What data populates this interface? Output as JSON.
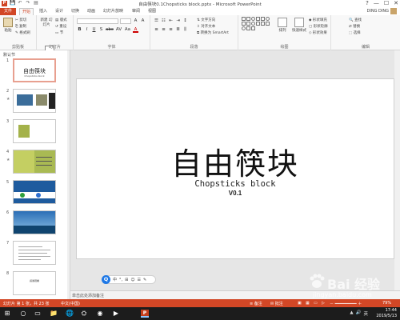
{
  "window": {
    "title": "自由筷块0.1Chopsticks block.pptx - Microsoft PowerPoint",
    "app_icon_label": "P",
    "minimize": "—",
    "maximize": "☐",
    "close": "✕",
    "qat": [
      "💾",
      "↶",
      "↷",
      "▤"
    ]
  },
  "tabs": {
    "file": "文件",
    "items": [
      "开始",
      "插入",
      "设计",
      "切换",
      "动画",
      "幻灯片放映",
      "审阅",
      "视图"
    ],
    "active_index": 0,
    "user": "DING DING",
    "help": "?"
  },
  "ribbon": {
    "clipboard": {
      "paste": "粘贴",
      "cut": "剪切",
      "copy": "复制",
      "format_painter": "格式刷",
      "label": "剪贴板"
    },
    "slides": {
      "new_slide": "新建\n幻灯片",
      "layout": "版式",
      "reset": "重设",
      "section": "节",
      "label": "幻灯片"
    },
    "font": {
      "label": "字体",
      "row1": [
        "B",
        "I",
        "U",
        "S",
        "abc",
        "AV",
        "Aa",
        "A"
      ],
      "grow": "A",
      "shrink": "A",
      "clear": "✗"
    },
    "paragraph": {
      "label": "段落",
      "text_direction": "文字方向",
      "align_text": "对齐文本",
      "smartart": "转换为 SmartArt"
    },
    "drawing": {
      "label": "绘图",
      "arrange": "排列",
      "quick_styles": "快速样式",
      "shape_fill": "形状填充",
      "shape_outline": "形状轮廓",
      "shape_effects": "形状效果"
    },
    "editing": {
      "label": "编辑",
      "find": "查找",
      "replace": "替换",
      "select": "选择"
    }
  },
  "thumbnails": {
    "section": "默认节",
    "slides": [
      {
        "num": "1",
        "title": "自由筷块",
        "subtitle": "Chopsticks block"
      },
      {
        "num": "2"
      },
      {
        "num": "3"
      },
      {
        "num": "4"
      },
      {
        "num": "5"
      },
      {
        "num": "6"
      },
      {
        "num": "7"
      },
      {
        "num": "8",
        "title": "感谢观看"
      }
    ],
    "selected_index": 0
  },
  "slide": {
    "title": "自由筷块",
    "subtitle": "Chopsticks block",
    "version": "V0.1"
  },
  "ime": {
    "logo": "Q",
    "items": [
      "中",
      "°,",
      "⊞",
      "☺",
      "☰",
      "✎"
    ]
  },
  "notes": {
    "placeholder": "单击此处添加备注"
  },
  "statusbar": {
    "slide_info": "幻灯片 第 1 张，共 23 张",
    "language": "中文(中国)",
    "notes": "备注",
    "comments": "批注",
    "zoom": "79%"
  },
  "taskbar": {
    "start": "⊞",
    "search": "○",
    "task_view": "▭",
    "apps": [
      "📁",
      "🌐",
      "⛭",
      "◉",
      "▶",
      "P"
    ],
    "time": "17:44",
    "date": "2019/5/13",
    "tray": [
      "▲",
      "🔊",
      "英"
    ]
  },
  "watermark": {
    "brand": "Bai 经验",
    "url": "jingyan.baidu.com"
  },
  "colors": {
    "accent": "#d24726",
    "taskbar": "#1c1c1c",
    "slide_bg": "#ffffff"
  }
}
